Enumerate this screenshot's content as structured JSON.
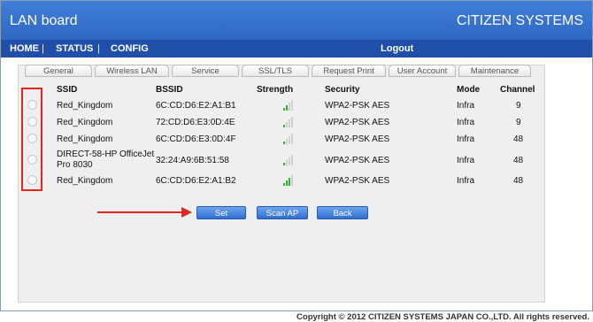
{
  "header": {
    "title": "LAN board",
    "brand": "CITIZEN SYSTEMS"
  },
  "nav": {
    "home": "HOME",
    "status": "STATUS",
    "config": "CONFIG",
    "logout": "Logout",
    "separator": "|"
  },
  "tabs": [
    "General",
    "Wireless LAN",
    "Service",
    "SSL/TLS",
    "Request Print",
    "User Account",
    "Maintenance"
  ],
  "table": {
    "headers": {
      "ssid": "SSID",
      "bssid": "BSSID",
      "strength": "Strength",
      "security": "Security",
      "mode": "Mode",
      "channel": "Channel"
    },
    "rows": [
      {
        "ssid": "Red_Kingdom",
        "ssid2": "",
        "bssid": "6C:CD:D6:E2:A1:B1",
        "strength_bars": 2,
        "security": "WPA2-PSK AES",
        "mode": "Infra",
        "channel": "9"
      },
      {
        "ssid": "Red_Kingdom",
        "ssid2": "",
        "bssid": "72:CD:D6:E3:0D:4E",
        "strength_bars": 1,
        "security": "WPA2-PSK AES",
        "mode": "Infra",
        "channel": "9"
      },
      {
        "ssid": "Red_Kingdom",
        "ssid2": "",
        "bssid": "6C:CD:D6:E3:0D:4F",
        "strength_bars": 1,
        "security": "WPA2-PSK AES",
        "mode": "Infra",
        "channel": "48"
      },
      {
        "ssid": "DIRECT-58-HP OfficeJet",
        "ssid2": "Pro 8030",
        "bssid": "32:24:A9:6B:51:58",
        "strength_bars": 1,
        "security": "WPA2-PSK AES",
        "mode": "Infra",
        "channel": "48"
      },
      {
        "ssid": "Red_Kingdom",
        "ssid2": "",
        "bssid": "6C:CD:D6:E2:A1:B2",
        "strength_bars": 3,
        "security": "WPA2-PSK AES",
        "mode": "Infra",
        "channel": "48"
      }
    ]
  },
  "buttons": {
    "set": "Set",
    "scan": "Scan AP",
    "back": "Back"
  },
  "footer": {
    "copyright": "Copyright © 2012 CITIZEN SYSTEMS JAPAN CO.,LTD. All rights reserved."
  },
  "colors": {
    "header_blue": "#2f68c3",
    "nav_blue": "#1f4fa8",
    "annotation_red": "#e4251b",
    "signal_green": "#2fb52f"
  }
}
